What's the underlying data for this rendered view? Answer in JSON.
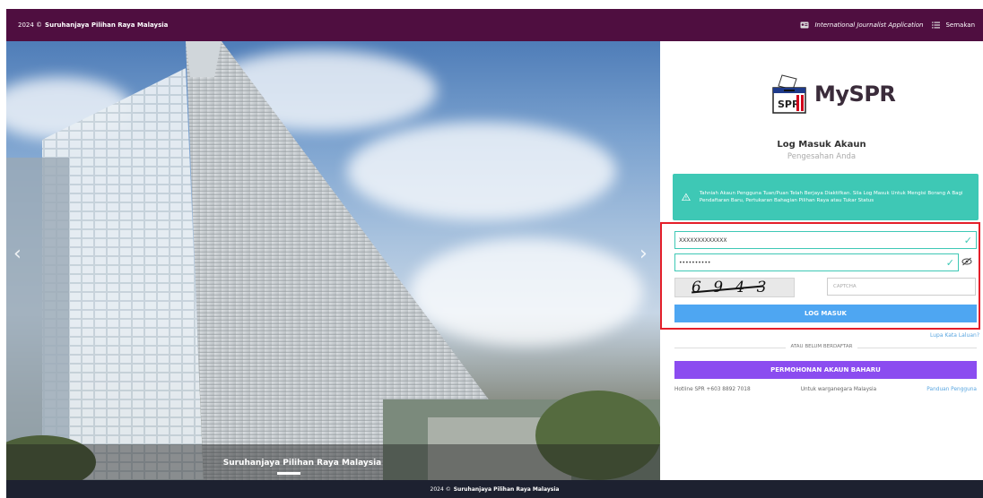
{
  "topbar": {
    "year": "2024 ©",
    "org": "Suruhanjaya Pilihan Raya Malaysia",
    "journalist_link": "International Journalist Application",
    "semakan_link": "Semakan"
  },
  "hero": {
    "caption": "Suruhanjaya Pilihan Raya Malaysia",
    "prev": "‹",
    "next": "›"
  },
  "login": {
    "brand": "MySPR",
    "logo_badge": "SPR",
    "title": "Log Masuk Akaun",
    "subtitle": "Pengesahan Anda",
    "alert": "Tahniah Akaun Pengguna Tuan/Puan Telah Berjaya Diaktifkan. Sila Log Masuk Untuk Mengisi Borang A Bagi Pendaftaran Baru, Pertukaran Bahagian Pilihan Raya atau Tukar Status",
    "username_value": "XXXXXXXXXXXXX",
    "password_value": "••••••••••",
    "captcha_text": "6 9 4 3",
    "captcha_placeholder": "CAPTCHA",
    "login_button": "LOG MASUK",
    "forgot_link": "Lupa Kata Laluan?",
    "divider_text": "ATAU BELUM BERDAFTAR",
    "register_button": "PERMOHONAN AKAUN BAHARU",
    "hotline": "Hotline SPR +603 8892 7018",
    "citizen_note": "Untuk warganegara Malaysia",
    "guide_link": "Panduan Pengguna"
  },
  "footer": {
    "year": "2024 ©",
    "org": "Suruhanjaya Pilihan Raya Malaysia"
  },
  "colors": {
    "topbar": "#4f0e40",
    "accent_teal": "#3ec8b5",
    "login_blue": "#4ea6f2",
    "register_purple": "#8b4cf0",
    "highlight_red": "#e41f2a",
    "footer": "#1d2130"
  },
  "icons": {
    "journalist": "id-card-icon",
    "semakan": "list-icon",
    "alert": "warning-triangle-icon",
    "check": "check-icon",
    "password_toggle": "eye-slash-icon",
    "logo": "ballot-box-icon"
  }
}
